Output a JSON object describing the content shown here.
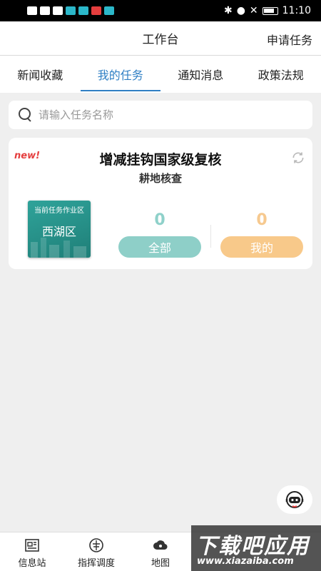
{
  "status_bar": {
    "time": "11:10"
  },
  "header": {
    "title": "工作台",
    "action": "申请任务"
  },
  "tabs": [
    {
      "label": "新闻收藏"
    },
    {
      "label": "我的任务"
    },
    {
      "label": "通知消息"
    },
    {
      "label": "政策法规"
    }
  ],
  "active_tab_index": 1,
  "search": {
    "placeholder": "请输入任务名称",
    "value": ""
  },
  "task_card": {
    "badge": "new!",
    "title": "增减挂钩国家级复核",
    "subtitle": "耕地核查",
    "area_caption": "当前任务作业区",
    "area_name": "西湖区",
    "all_count": "0",
    "all_label": "全部",
    "mine_count": "0",
    "mine_label": "我的"
  },
  "bottom_nav": [
    {
      "label": "信息站",
      "icon": "newspaper-icon"
    },
    {
      "label": "指挥调度",
      "icon": "dispatch-icon"
    },
    {
      "label": "地图",
      "icon": "map-cloud-icon"
    }
  ],
  "watermark": {
    "main": "下载吧应用",
    "sub": "www.xiazaiba.com"
  },
  "colors": {
    "accent": "#2f7fc4",
    "teal_button": "#8ecfc8",
    "orange_button": "#f8c98a",
    "new_badge": "#e53e3e"
  }
}
